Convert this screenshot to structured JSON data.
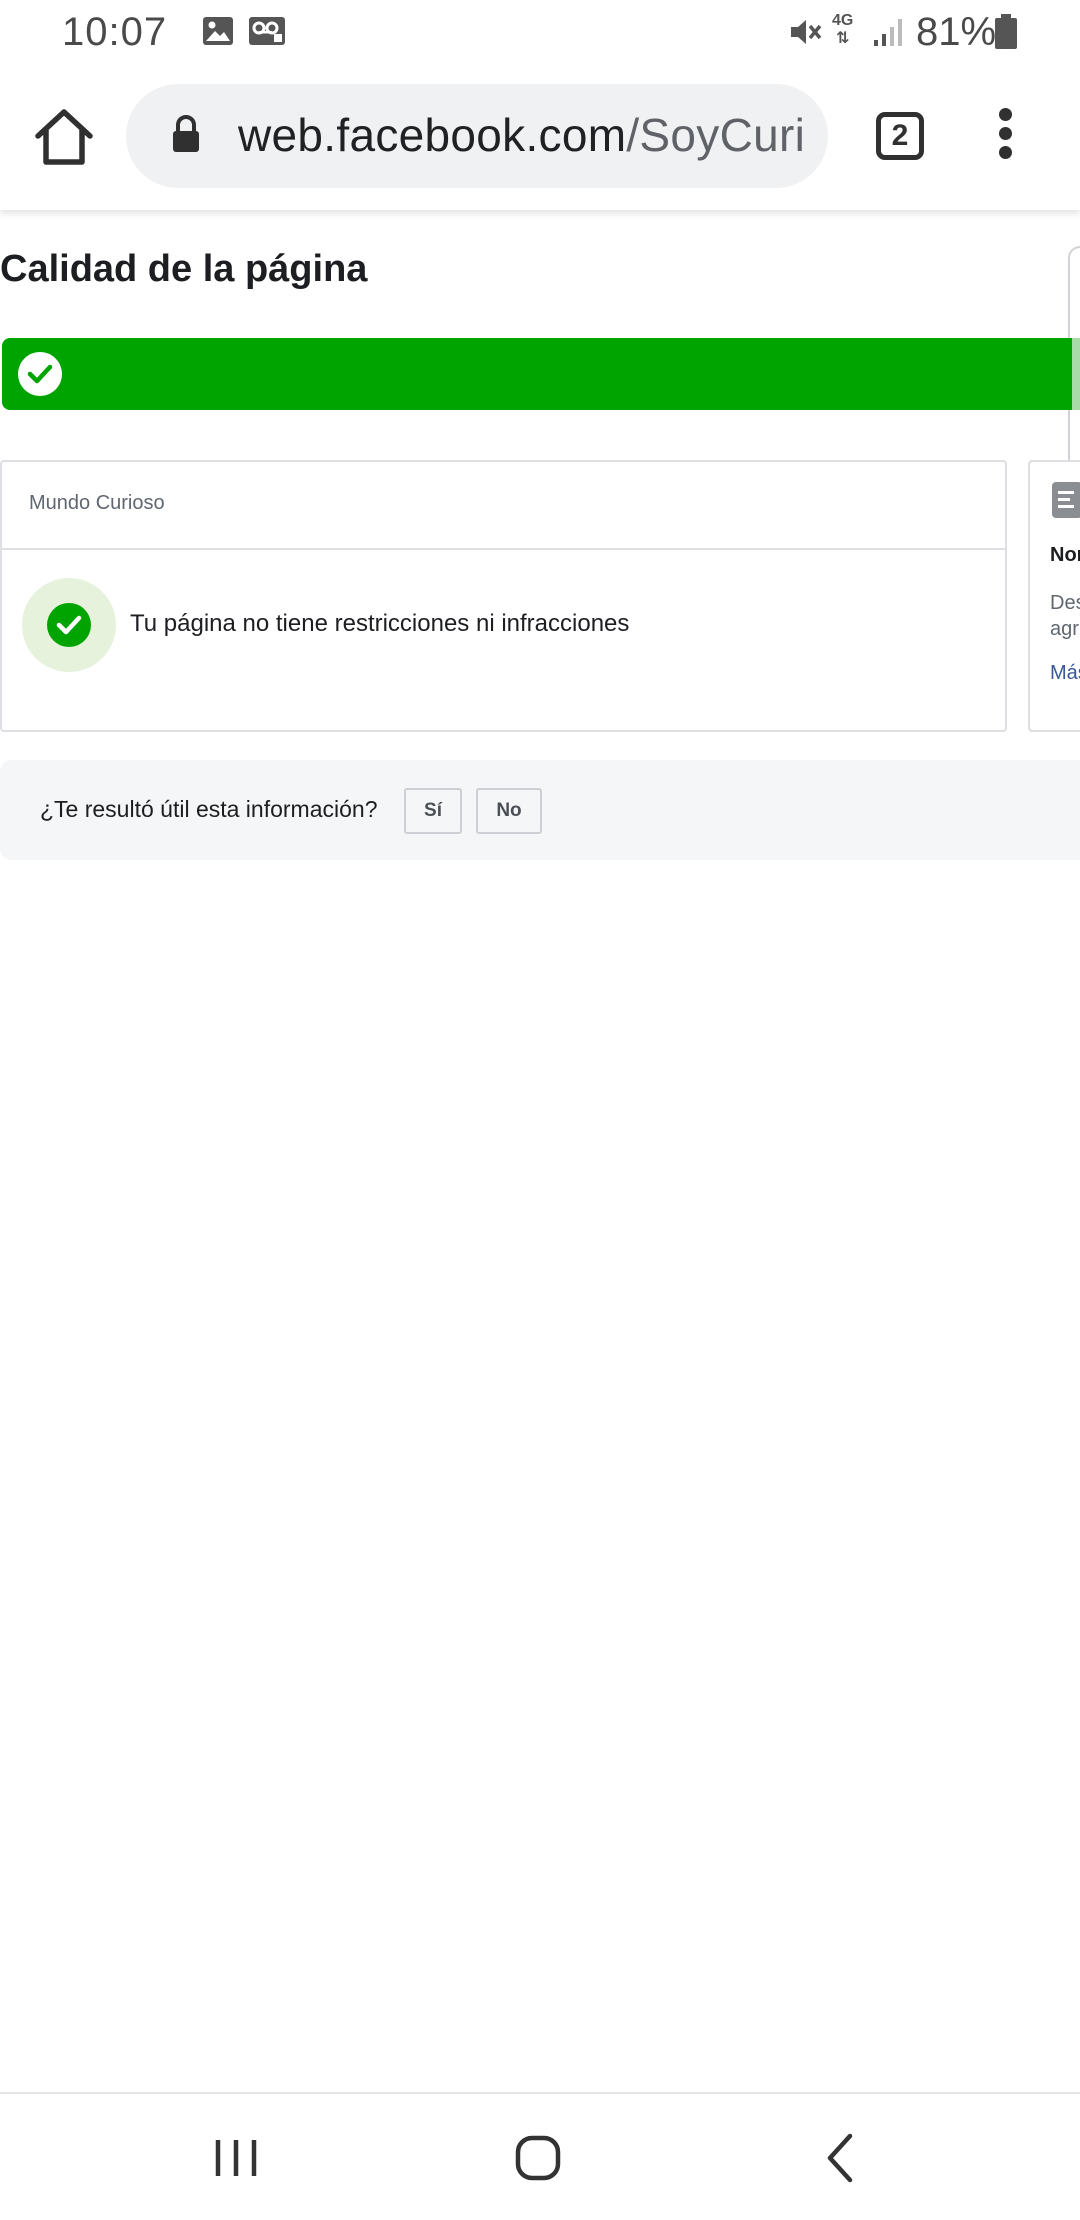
{
  "status_bar": {
    "time": "10:07",
    "battery": "81%",
    "network": "4G",
    "icons": [
      "image-icon",
      "voicemail-icon",
      "mute-icon",
      "network-4g-icon",
      "signal-icon",
      "battery-icon"
    ]
  },
  "browser": {
    "url_domain": "web.facebook.com",
    "url_path": "/SoyCuri",
    "tab_count": "2"
  },
  "page": {
    "title": "Calidad de la página",
    "banner_color": "#00a400"
  },
  "page_card": {
    "page_name": "Mundo Curioso",
    "status_message": "Tu página no tiene restricciones ni infracciones"
  },
  "side_card": {
    "title": "Nor",
    "desc_line1": "Des",
    "desc_line2": "agr",
    "link": "Más"
  },
  "feedback": {
    "question": "¿Te resultó útil esta información?",
    "yes_label": "Sí",
    "no_label": "No"
  }
}
